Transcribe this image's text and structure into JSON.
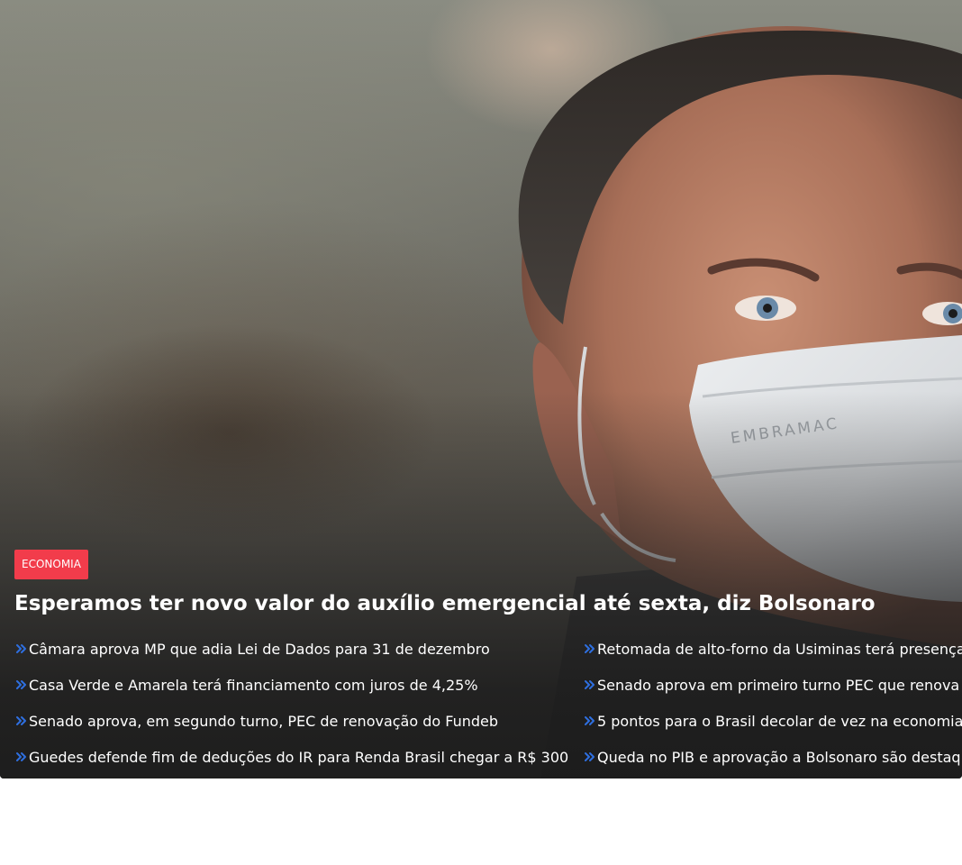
{
  "category": "ECONOMIA",
  "headline": "Esperamos ter novo valor do auxílio emergencial até sexta, diz Bolsonaro",
  "photo": {
    "subject": "man-wearing-face-mask",
    "mask_text": "EMBRAMAC"
  },
  "colors": {
    "badge": "#f23c4b",
    "chevron": "#2e6fe0",
    "text": "#ffffff"
  },
  "related_left": [
    "Câmara aprova MP que adia Lei de Dados para 31 de dezembro",
    "Casa Verde e Amarela terá financiamento com juros de 4,25%",
    "Senado aprova, em segundo turno, PEC de renovação do Fundeb",
    "Guedes defende fim de deduções do IR para Renda Brasil chegar a R$ 300"
  ],
  "related_right": [
    "Retomada de alto-forno da Usiminas terá presença",
    "Senado aprova em primeiro turno PEC que renova",
    "5 pontos para o Brasil decolar de vez na economia",
    "Queda no PIB e aprovação a Bolsonaro são destaq"
  ]
}
